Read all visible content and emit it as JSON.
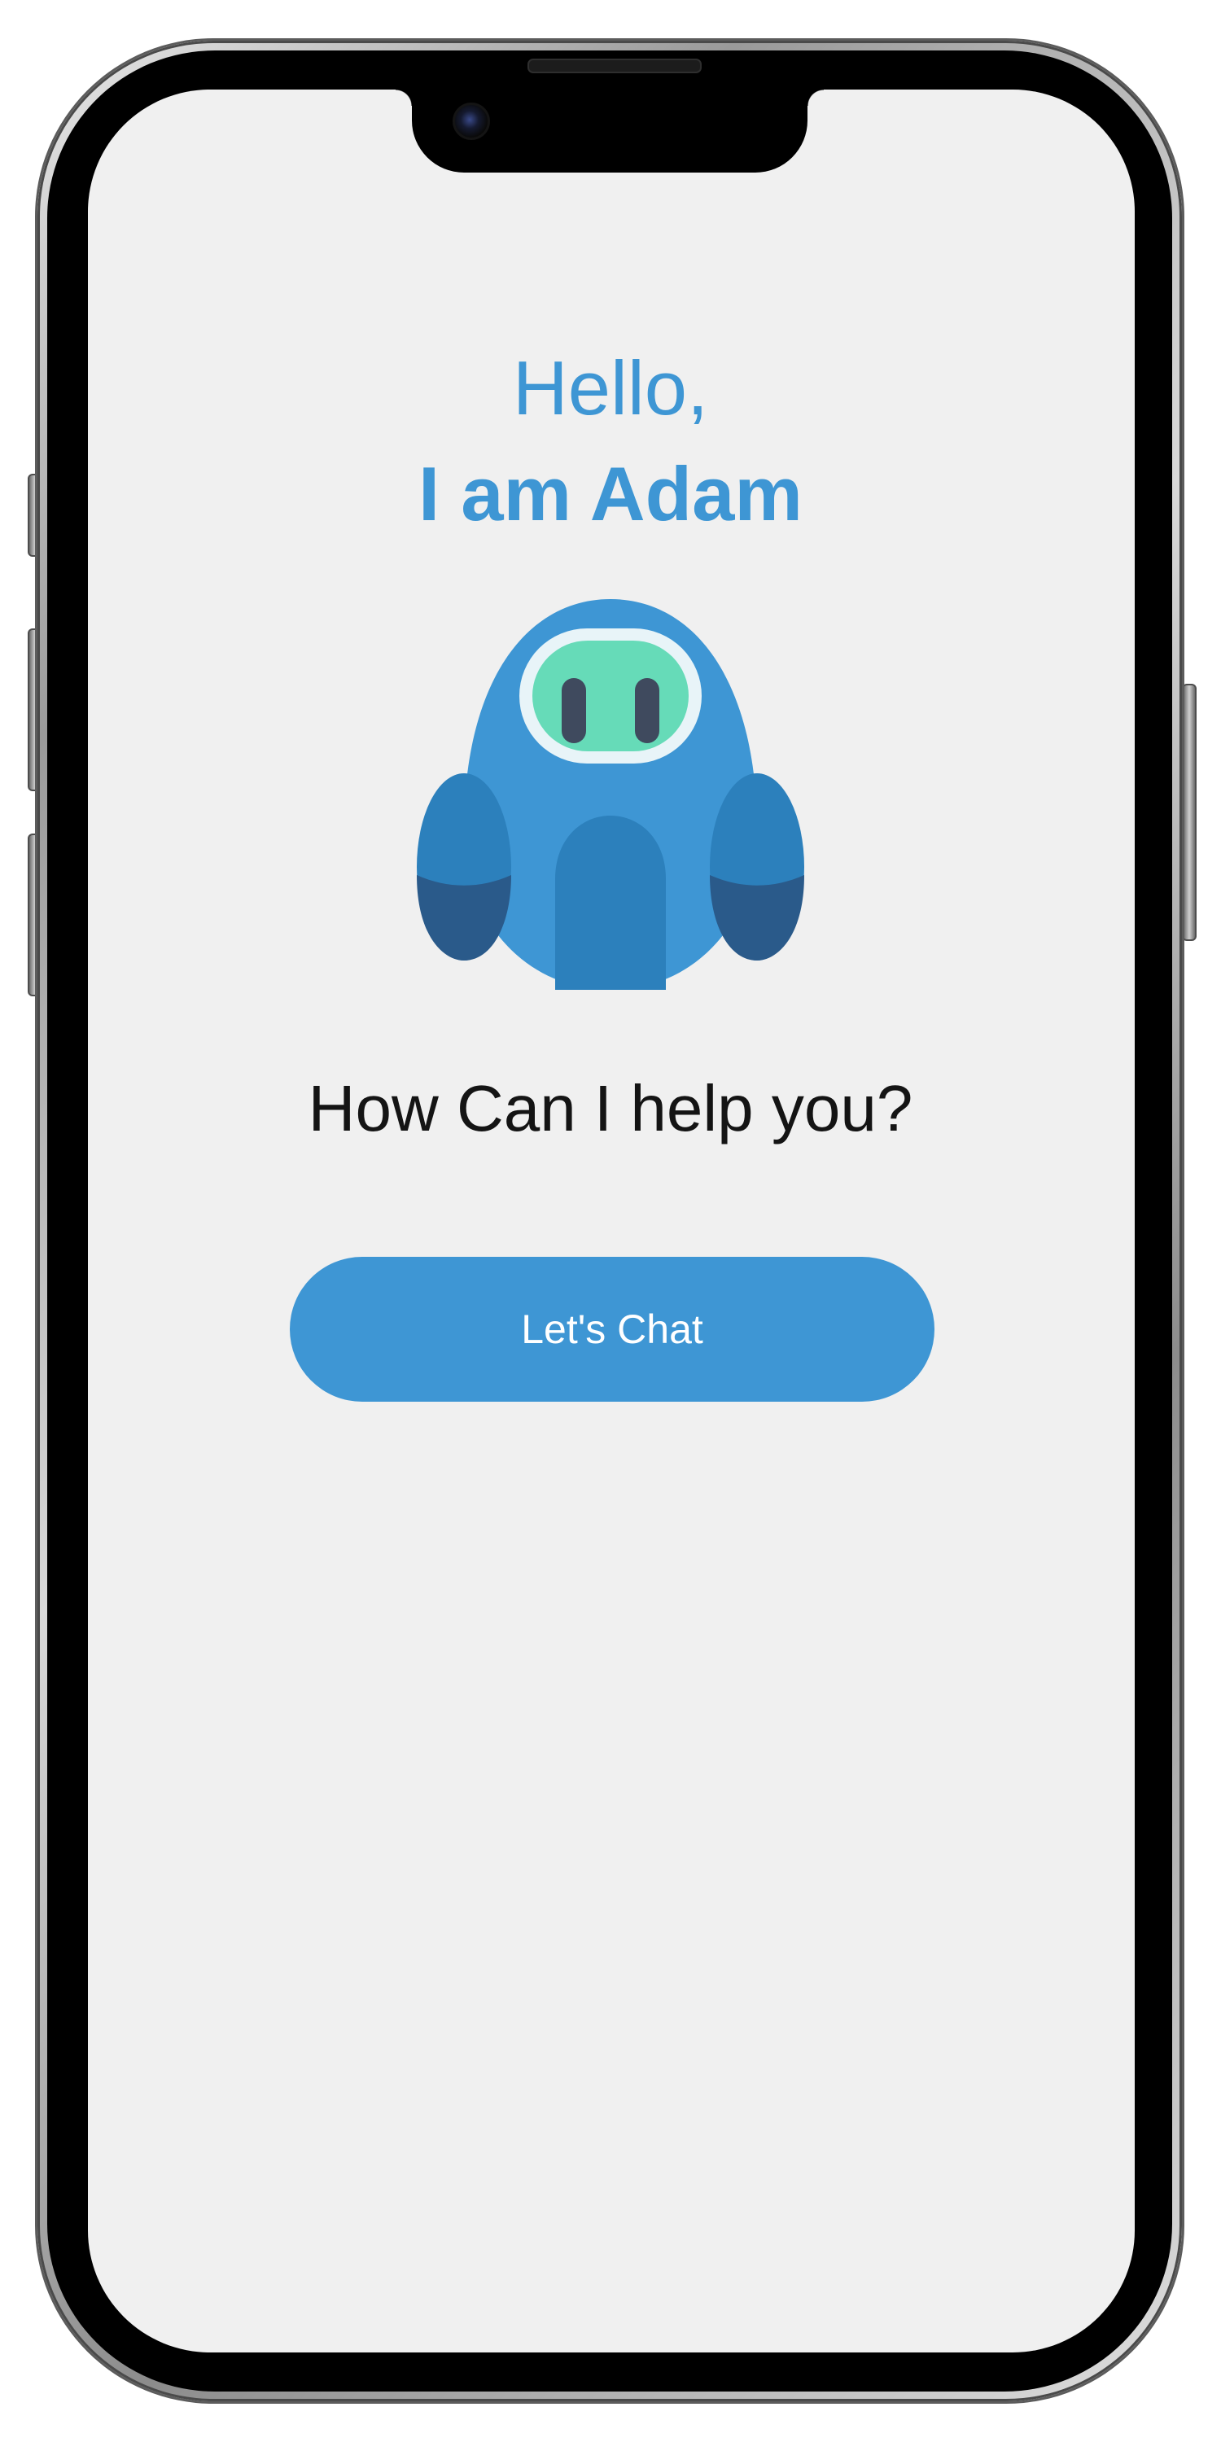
{
  "greeting": {
    "hello": "Hello,",
    "name": "I am Adam"
  },
  "robot": {
    "icon": "robot-mascot-icon",
    "colors": {
      "body": "#3e96d4",
      "body_dark": "#2c80bc",
      "arm_shadow": "#2a5a8a",
      "visor_frame": "#e8f4f8",
      "visor": "#66dbb8",
      "eyes": "#3f4a5e"
    }
  },
  "prompt": {
    "question": "How Can I help you?"
  },
  "actions": {
    "chat_label": "Let's Chat"
  },
  "theme": {
    "accent": "#3e96d4",
    "screen_background": "#f0f0f0",
    "text": "#141414"
  }
}
